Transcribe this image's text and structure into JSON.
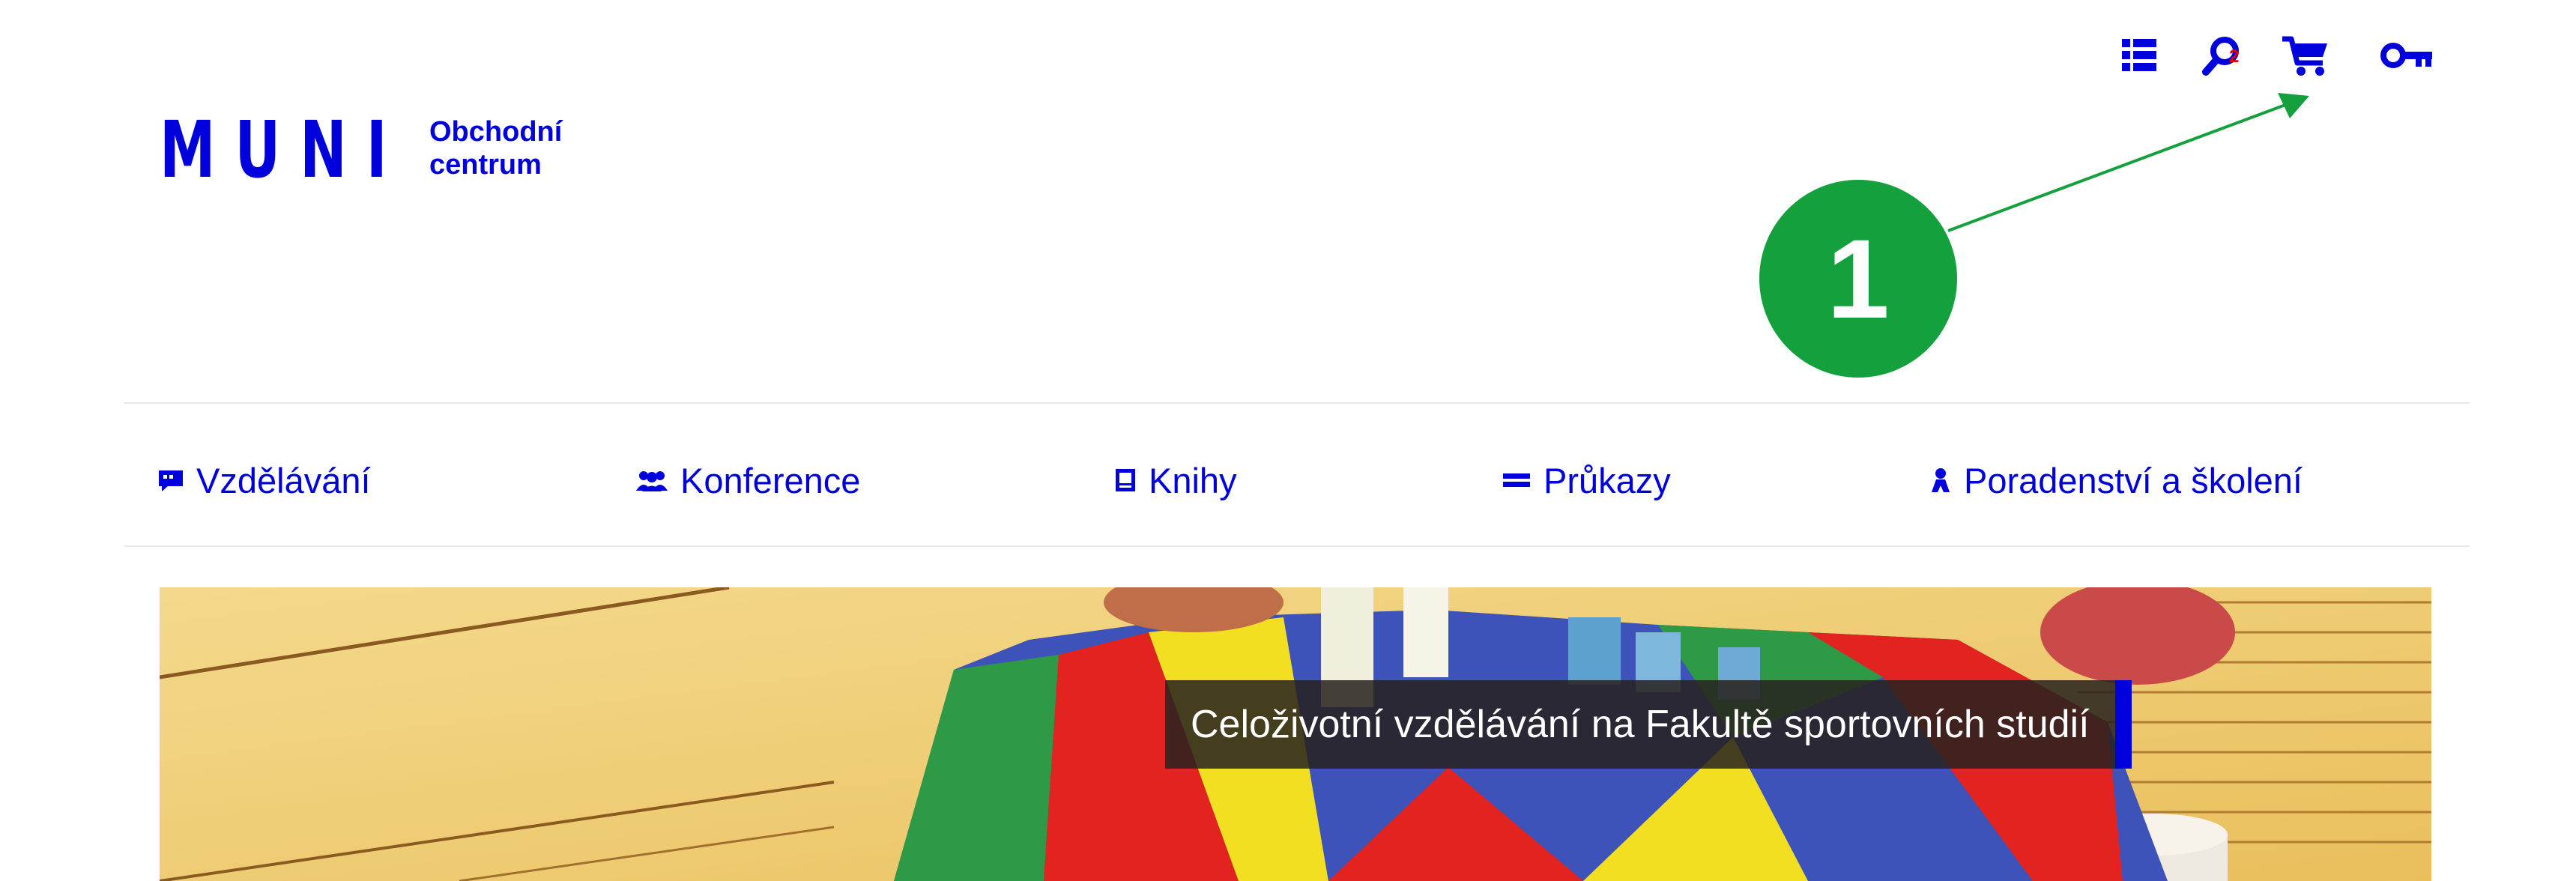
{
  "header": {
    "logo_text": "MUNI",
    "logo_subtitle_line1": "Obchodní",
    "logo_subtitle_line2": "centrum",
    "icons": [
      "list-icon",
      "search-icon",
      "cart-icon",
      "key-icon"
    ],
    "cart_count": "2"
  },
  "annotation": {
    "label": "1",
    "color": "#14a03c"
  },
  "nav": {
    "items": [
      {
        "icon": "comment-icon",
        "label": "Vzdělávání"
      },
      {
        "icon": "users-icon",
        "label": "Konference"
      },
      {
        "icon": "book-icon",
        "label": "Knihy"
      },
      {
        "icon": "card-icon",
        "label": "Průkazy"
      },
      {
        "icon": "person-icon",
        "label": "Poradenství a školení"
      }
    ]
  },
  "hero": {
    "caption": "Celoživotní vzdělávání na Fakultě sportovních studií"
  },
  "colors": {
    "brand": "#0000dc",
    "badge": "#14a03c",
    "cart_count": "#e00000"
  }
}
